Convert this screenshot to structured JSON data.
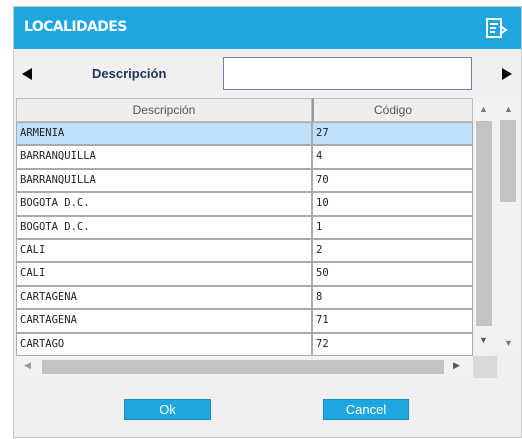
{
  "dialog": {
    "title": "LOCALIDADES",
    "menu_icon": "list-settings-icon"
  },
  "search": {
    "label": "Descripción",
    "value": "",
    "placeholder": "",
    "prev_icon": "arrow-left-icon",
    "next_icon": "arrow-right-icon"
  },
  "grid": {
    "columns": [
      "Descripción",
      "Código"
    ],
    "rows": [
      {
        "desc": "ARMENIA",
        "code": "27",
        "selected": true
      },
      {
        "desc": "BARRANQUILLA",
        "code": "4"
      },
      {
        "desc": "BARRANQUILLA",
        "code": "70"
      },
      {
        "desc": "BOGOTA D.C.",
        "code": "10"
      },
      {
        "desc": "BOGOTA D.C.",
        "code": "1"
      },
      {
        "desc": "CALI",
        "code": "2"
      },
      {
        "desc": "CALI",
        "code": "50"
      },
      {
        "desc": "CARTAGENA",
        "code": "8"
      },
      {
        "desc": "CARTAGENA",
        "code": "71"
      },
      {
        "desc": "CARTAGO",
        "code": "72"
      }
    ]
  },
  "buttons": {
    "ok": "Ok",
    "cancel": "Cancel"
  },
  "colors": {
    "accent": "#1ea6e0",
    "selected_row": "#bfe0fb"
  }
}
